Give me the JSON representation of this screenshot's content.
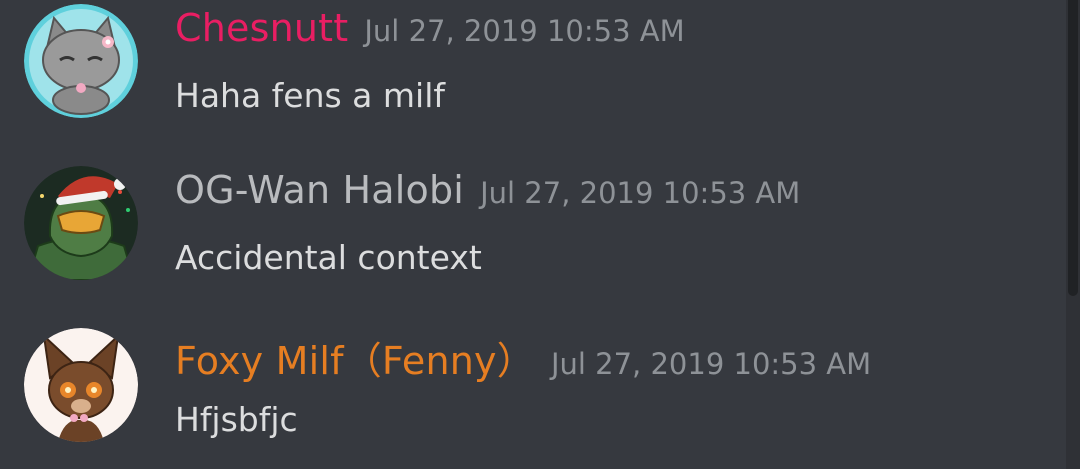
{
  "colors": {
    "background": "#36393f",
    "message_text": "#dcddde",
    "timestamp": "#8e9297"
  },
  "messages": [
    {
      "username": "Chesnutt",
      "username_color": "#e91e63",
      "timestamp": "Jul 27, 2019 10:53 AM",
      "text": "Haha fens a milf",
      "avatar_icon": "gray-cat-avatar"
    },
    {
      "username": "OG-Wan Halobi",
      "username_color": "#b9bbbe",
      "timestamp": "Jul 27, 2019 10:53 AM",
      "text": "Accidental context",
      "avatar_icon": "master-chief-santa-hat-avatar"
    },
    {
      "username": "Foxy Milf（Fenny）",
      "username_color": "#e67e22",
      "timestamp": "Jul 27, 2019 10:53 AM",
      "text": "Hfjsbfjc",
      "avatar_icon": "brown-fox-avatar"
    }
  ]
}
